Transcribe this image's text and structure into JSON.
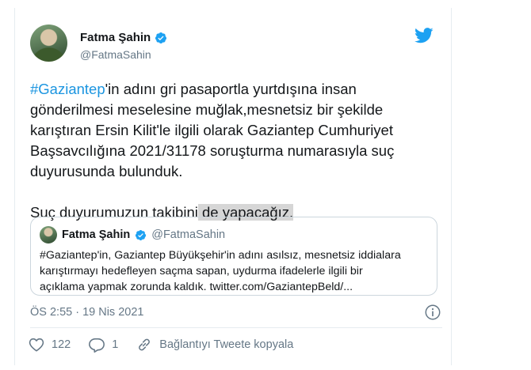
{
  "tweet": {
    "author": {
      "display_name": "Fatma Şahin",
      "handle": "@FatmaSahin",
      "verified_icon": "verified-badge-icon"
    },
    "brand_icon": "twitter-bird-icon",
    "text": {
      "hashtag": "#Gaziantep",
      "line1_rest": "'in adını gri pasaportla yurtdışına insan",
      "line2": "gönderilmesi meselesine muğlak,mesnetsiz bir şekilde",
      "line3": "karıştıran Ersin Kilit'le ilgili olarak Gaziantep Cumhuriyet",
      "line4": "Başsavcılığına 2021/31178 soruşturma numarasıyla suç",
      "line5": "duyurusunda bulunduk.",
      "line6_normal": "Suç duyurumuzun takibini",
      "line6_highlight": " de yapacağız."
    },
    "quoted": {
      "display_name": "Fatma Şahin",
      "handle": "@FatmaSahin",
      "line1": "#Gaziantep'in, Gaziantep Büyükşehir'in adını asılsız, mesnetsiz iddialara",
      "line2": "karıştırmayı hedefleyen saçma sapan, uydurma ifadelerle ilgili bir",
      "line3": "açıklama yapmak zorunda kaldık. twitter.com/GaziantepBeld/..."
    },
    "timestamp": "ÖS 2:55 · 19 Nis 2021",
    "actions": {
      "likes": "122",
      "replies": "1",
      "copy_link": "Bağlantıyı Tweete kopyala"
    }
  },
  "colors": {
    "accent": "#1b95e0",
    "twitter_blue": "#1da1f2",
    "muted": "#657786",
    "border": "#e6ecf0"
  }
}
